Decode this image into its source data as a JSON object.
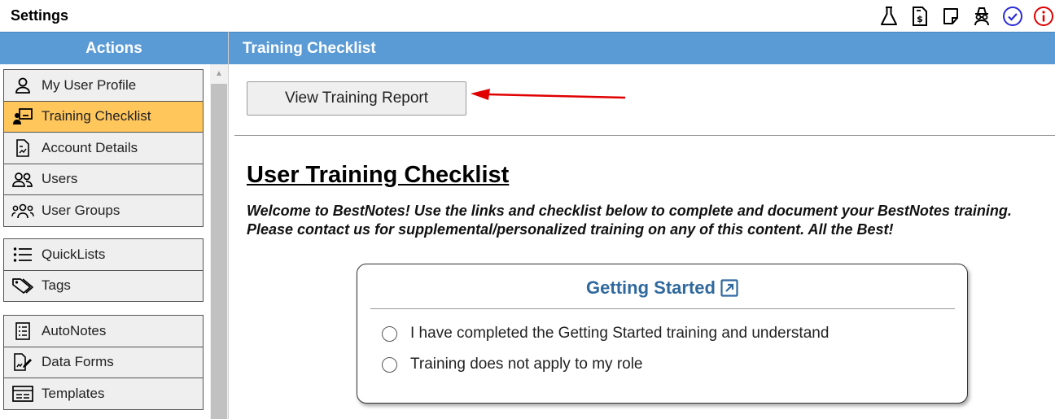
{
  "app": {
    "title": "Settings"
  },
  "top_icons": [
    {
      "name": "flask-icon",
      "color": "#000000"
    },
    {
      "name": "invoice-dollar-icon",
      "color": "#000000"
    },
    {
      "name": "sticky-note-icon",
      "color": "#000000"
    },
    {
      "name": "incognito-user-icon",
      "color": "#000000"
    },
    {
      "name": "check-circle-icon",
      "color": "#2b2bd6"
    },
    {
      "name": "info-circle-icon",
      "color": "#e00000"
    }
  ],
  "sidebar": {
    "header": "Actions",
    "groups": [
      [
        {
          "label": "My User Profile",
          "icon": "user-icon"
        },
        {
          "label": "Training Checklist",
          "icon": "presentation-user-icon",
          "active": true
        },
        {
          "label": "Account Details",
          "icon": "document-chart-icon"
        },
        {
          "label": "Users",
          "icon": "users-icon"
        },
        {
          "label": "User Groups",
          "icon": "user-group-icon"
        }
      ],
      [
        {
          "label": "QuickLists",
          "icon": "list-icon"
        },
        {
          "label": "Tags",
          "icon": "tags-icon"
        }
      ],
      [
        {
          "label": "AutoNotes",
          "icon": "checklist-icon"
        },
        {
          "label": "Data Forms",
          "icon": "form-edit-icon"
        },
        {
          "label": "Templates",
          "icon": "template-icon"
        }
      ]
    ]
  },
  "main": {
    "header": "Training Checklist",
    "view_report_button": "View Training Report",
    "checklist_title": "User Training Checklist",
    "welcome_text": "Welcome to BestNotes! Use the links and checklist below to complete and document your BestNotes training. Please contact us for supplemental/personalized training on any of this content. All the Best!",
    "card": {
      "title": "Getting Started",
      "options": [
        "I have completed the Getting Started training and understand",
        "Training does not apply to my role"
      ]
    }
  },
  "colors": {
    "header_bg": "#5b9bd5",
    "active_item_bg": "#ffc65c",
    "card_title": "#30699e",
    "arrow": "#e00000"
  }
}
